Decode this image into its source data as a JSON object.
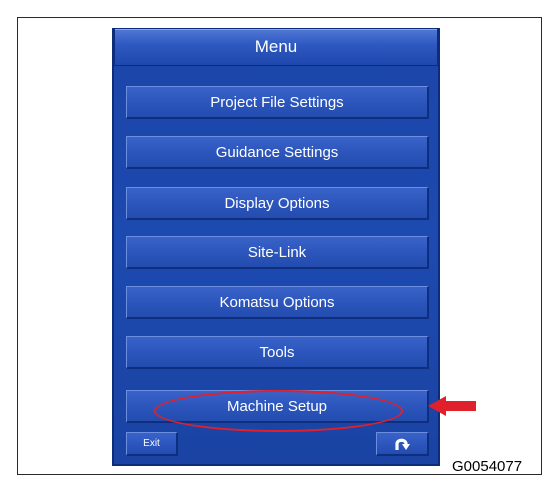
{
  "menu": {
    "title": "Menu",
    "items": [
      {
        "label": "Project File Settings"
      },
      {
        "label": "Guidance Settings"
      },
      {
        "label": "Display Options"
      },
      {
        "label": "Site-Link"
      },
      {
        "label": "Komatsu Options"
      },
      {
        "label": "Tools"
      },
      {
        "label": "Machine Setup"
      }
    ]
  },
  "footer": {
    "exit_label": "Exit",
    "back_icon": "return-arrow-icon"
  },
  "annotation": {
    "figure_id": "G0054077",
    "highlighted_item": "Machine Setup",
    "highlight_color": "#e0202a"
  },
  "colors": {
    "panel": "#1d4ab0",
    "button": "#2b55bb",
    "title": "#2d58bf"
  }
}
